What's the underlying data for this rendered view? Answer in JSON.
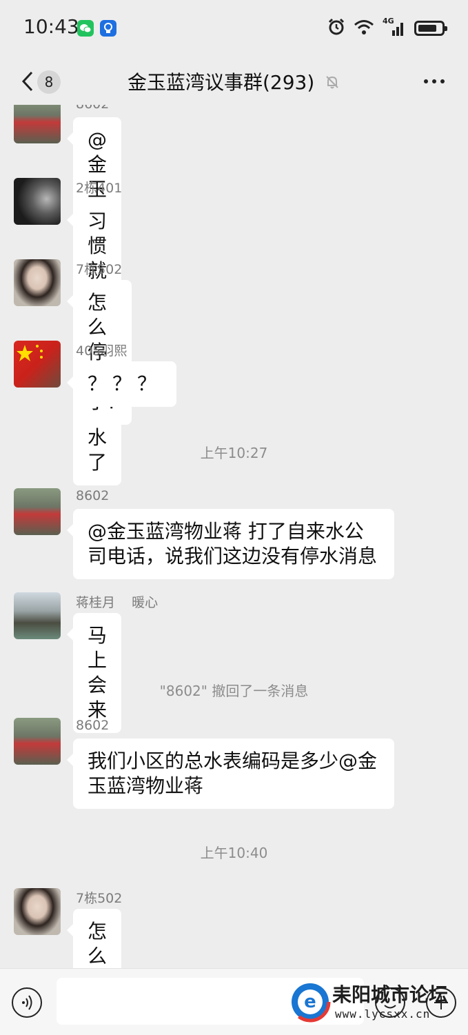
{
  "status_bar": {
    "time": "10:43",
    "network": "4G"
  },
  "header": {
    "back_count": "8",
    "title": "金玉蓝湾议事群(293)"
  },
  "messages": [
    {
      "sender": "8602",
      "text": "@金玉蓝湾物业蒋  怎么又停水了"
    },
    {
      "sender": "2栋401",
      "text": "习惯就好"
    },
    {
      "sender": "7栋502",
      "text": "怎么停水了?"
    },
    {
      "sender": "405羽熙",
      "text": "？？？"
    },
    {
      "sender": "8602",
      "text": "@金玉蓝湾物业蒋  打了自来水公司电话，说我们这边没有停水消息"
    },
    {
      "sender": "蒋桂月    暖心",
      "text": "马上会来"
    },
    {
      "sender": "8602",
      "text": "我们小区的总水表编码是多少@金玉蓝湾物业蒋"
    },
    {
      "sender": "7栋502",
      "text": "怎么老停水"
    }
  ],
  "timestamps": [
    "上午10:27",
    "上午10:40"
  ],
  "system_messages": [
    "\"8602\" 撤回了一条消息"
  ],
  "watermark": {
    "text": "耒阳城市论坛",
    "url": "www.lycsxx.cn"
  },
  "icons": {
    "wechat": "wechat-icon",
    "app2": "bulb-icon",
    "alarm": "alarm-icon",
    "wifi": "wifi-icon",
    "signal": "signal-icon",
    "battery": "battery-icon",
    "back": "back-chevron-icon",
    "mute": "mute-bell-icon",
    "more": "more-dots-icon",
    "voice": "voice-icon",
    "emoji": "emoji-icon",
    "plus": "plus-icon"
  }
}
